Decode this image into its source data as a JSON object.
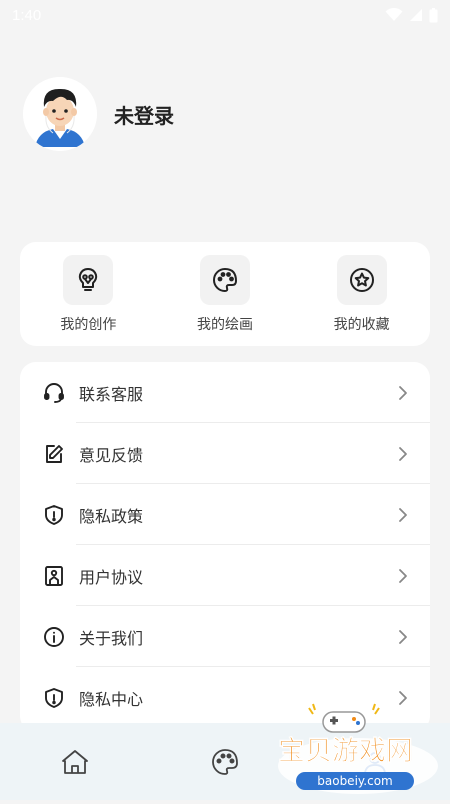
{
  "status_bar": {
    "time": "1:40"
  },
  "profile": {
    "login_status": "未登录"
  },
  "quick_actions": [
    {
      "label": "我的创作",
      "icon": "lightbulb-icon"
    },
    {
      "label": "我的绘画",
      "icon": "palette-icon"
    },
    {
      "label": "我的收藏",
      "icon": "star-icon"
    }
  ],
  "menu": [
    {
      "label": "联系客服",
      "icon": "headset-icon"
    },
    {
      "label": "意见反馈",
      "icon": "edit-note-icon"
    },
    {
      "label": "隐私政策",
      "icon": "shield-icon"
    },
    {
      "label": "用户协议",
      "icon": "bookmark-icon"
    },
    {
      "label": "关于我们",
      "icon": "info-icon"
    },
    {
      "label": "隐私中心",
      "icon": "shield-icon"
    }
  ],
  "bottom_nav": [
    {
      "icon": "home-icon"
    },
    {
      "icon": "palette-icon"
    },
    {
      "icon": "profile-icon"
    }
  ],
  "watermark": {
    "title": "宝贝游戏网",
    "url": "baobeiy.com"
  },
  "colors": {
    "accent_blue": "#2f74d0",
    "watermark_orange": "#f08a16",
    "page_bg": "#f4f4f4"
  }
}
